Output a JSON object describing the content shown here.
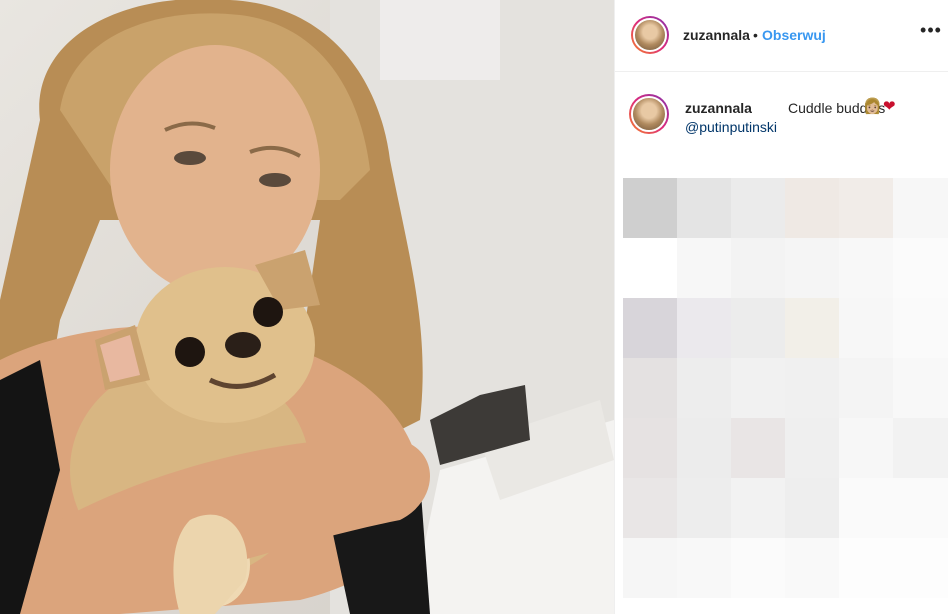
{
  "post": {
    "image_alt": "Selfie of a blonde woman hugging a small fawn chihuahua",
    "author": "zuzannala",
    "separator": "•",
    "follow_label": "Obserwuj",
    "more_icon": "more-horizontal-icon",
    "caption_user": "zuzannala",
    "caption_text": "Cuddle buddies",
    "caption_emoji_1": "👩🏼",
    "caption_emoji_2": "❤",
    "caption_mention": "@putinputinski"
  },
  "colors": {
    "follow": "#3897f0",
    "mention": "#003569",
    "text": "#262626",
    "divider": "#efefef"
  }
}
